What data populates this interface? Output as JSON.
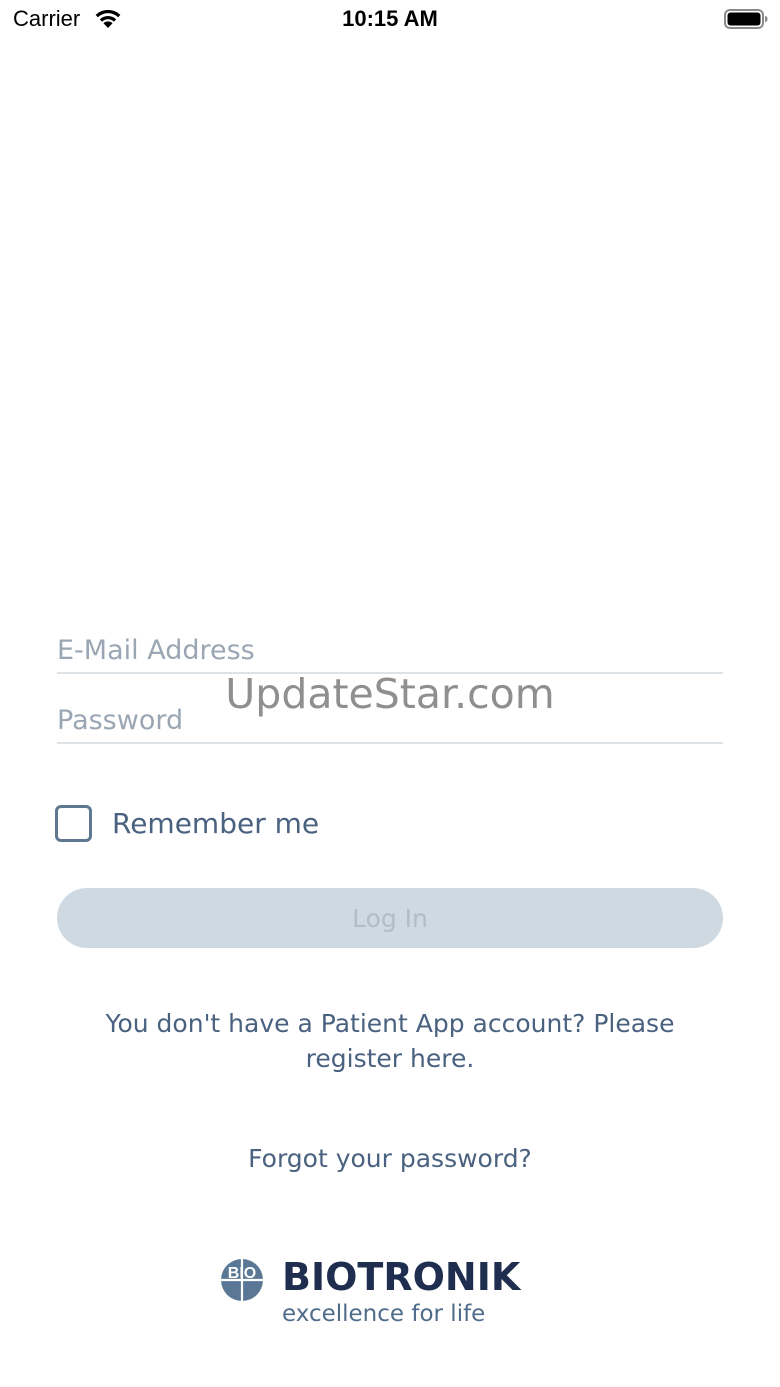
{
  "status_bar": {
    "carrier": "Carrier",
    "time": "10:15 AM",
    "wifi_icon": "wifi-icon",
    "battery_icon": "battery-full-icon"
  },
  "login_form": {
    "email_placeholder": "E-Mail Address",
    "email_value": "",
    "password_placeholder": "Password",
    "password_value": "",
    "remember_label": "Remember me",
    "remember_checked": false,
    "login_button_label": "Log In",
    "login_button_enabled": false,
    "register_text": "You don't have a Patient App account? Please register here.",
    "forgot_text": "Forgot your password?"
  },
  "watermark": "UpdateStar.com",
  "brand": {
    "logo_mark_text": "BIO",
    "name": "BIOTRONIK",
    "tagline": "excellence for life"
  },
  "colors": {
    "text": "#4a6280",
    "placeholder": "#9aa6b3",
    "button_disabled_bg": "#cfd9e1",
    "button_disabled_text": "#b1bdc8",
    "brand_navy": "#1f2d4f",
    "logo_mark": "#5a7895"
  }
}
